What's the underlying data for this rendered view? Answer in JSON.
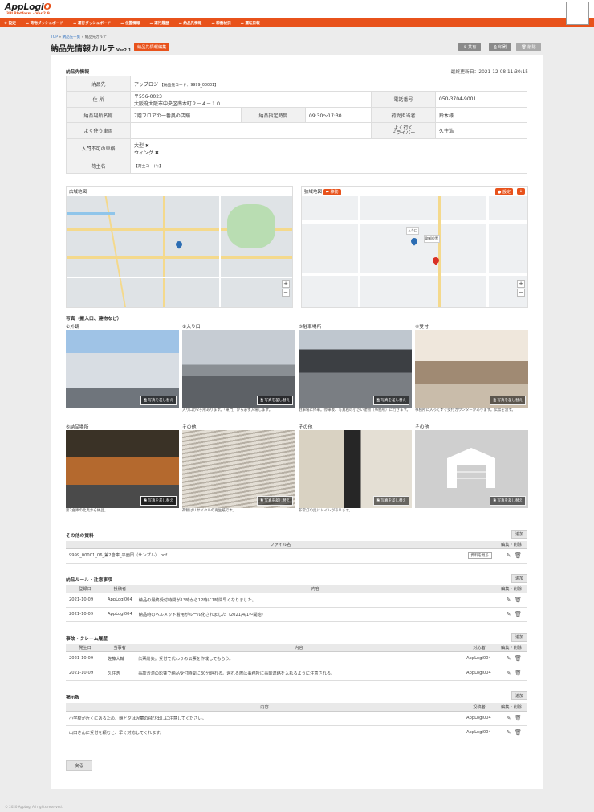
{
  "header": {
    "logo": "AppLogi",
    "logo_o": "O",
    "logo_sub": "3PLPlatform - Ver.2.9"
  },
  "nav": [
    "設定",
    "荷物ダッシュボード",
    "運行ダッシュボード",
    "位置情報",
    "運行履歴",
    "納品先情報",
    "稼働状況",
    "運転日報"
  ],
  "breadcrumb": {
    "top": "TOP",
    "list": "納品先一覧",
    "current": "納品先カルテ"
  },
  "page": {
    "title": "納品先情報カルテ",
    "version": "Ver2.1",
    "edit_label": "納品先情報編集",
    "share": "共有",
    "print": "印刷",
    "delete": "削除"
  },
  "info": {
    "section": "納品先情報",
    "updated": "最終更新日：2021-12-08 11:30:15",
    "dest_label": "納品先",
    "dest_value": "アップロジ",
    "dest_code": "【納品先コード：9999_00001】",
    "addr_label": "住 所",
    "addr_zip": "〒556-0023",
    "addr_line": "大阪府大阪市中央区南本町２－４－１０",
    "tel_label": "電話番号",
    "tel_value": "050-3704-9001",
    "place_label": "納品場所名称",
    "place_value": "7階フロアの一番奥の店舗",
    "time_label": "納品指定時間",
    "time_value": "09:30〜17:30",
    "person_label": "荷受担当者",
    "person_value": "鈴木様",
    "car_label": "よく使う車両",
    "driver_label": "よく行く\nドライバー",
    "driver_value": "久住浩",
    "ban_label": "入門不可の車格",
    "ban_1": "大型 ✖",
    "ban_2": "ウィング ✖",
    "owner_label": "荷主名",
    "owner_value": "【荷主コード：】"
  },
  "maps": {
    "wide": "広域地図",
    "narrow": "狭域地図",
    "move": "移動",
    "set": "設定",
    "entrance": "入り口",
    "current": "取卸位置"
  },
  "photos": {
    "section": "写真（搬入口、建物など）",
    "btn": "写真を差し替え",
    "items": [
      {
        "label": "①外観",
        "caption": ""
      },
      {
        "label": "②入り口",
        "caption": "入り口が2ヶ所あります。「東門」から必ず入場します。"
      },
      {
        "label": "③駐車場所",
        "caption": "駐車場に停車。停車後、写真右の小さい建物（事務所）に行きます。"
      },
      {
        "label": "④受付",
        "caption": "事務所に入ってすぐ受付カウンターがあります。伝票を渡す。"
      },
      {
        "label": "⑤納品場所",
        "caption": "第2倉庫の北奥から納品。"
      },
      {
        "label": "その他",
        "caption": "荷物はリサイクルの再生紙です。"
      },
      {
        "label": "その他",
        "caption": "非常灯の奥にトイレがあります。"
      },
      {
        "label": "その他",
        "caption": ""
      }
    ]
  },
  "docs": {
    "section": "その他の資料",
    "add": "追加",
    "col_file": "ファイル名",
    "col_edit": "編集・削除",
    "file": "9999_00001_06_第2倉庫_平面図（サンプル）.pdf",
    "view": "資料を見る"
  },
  "rules": {
    "section": "納品ルール・注意事項",
    "add": "追加",
    "col_date": "登録日",
    "col_user": "投稿者",
    "col_content": "内容",
    "col_edit": "編集・削除",
    "rows": [
      {
        "date": "2021-10-09",
        "user": "AppLogi004",
        "content": "納品の最終受付時間が13時から12時に1時間早くなりました。"
      },
      {
        "date": "2021-10-09",
        "user": "AppLogi004",
        "content": "納品時のヘルメット着用がルール化されました（2021/4/1〜開始）"
      }
    ]
  },
  "incidents": {
    "section": "事故・クレーム履歴",
    "add": "追加",
    "col_date": "発生日",
    "col_who": "当事者",
    "col_content": "内容",
    "col_resp": "対応者",
    "col_edit": "編集・削除",
    "rows": [
      {
        "date": "2021-10-09",
        "who": "佐藤大輔",
        "content": "伝票紛失。受付で代わりの伝票を作成してもらう。",
        "resp": "AppLogi004"
      },
      {
        "date": "2021-10-09",
        "who": "久住浩",
        "content": "事故渋滞の影響で納品受付時間に30分遅れる。遅れる際は事務所に事前連絡を入れるように注意される。",
        "resp": "AppLogi004"
      }
    ]
  },
  "board": {
    "section": "掲示板",
    "add": "追加",
    "col_content": "内容",
    "col_user": "投稿者",
    "col_edit": "編集・削除",
    "rows": [
      {
        "content": "小学校が近くにあるため、朝と夕は児童の飛び出しに注意してください。",
        "user": "AppLogi004"
      },
      {
        "content": "山田さんに受付を頼むと、早く対応してくれます。",
        "user": "AppLogi004"
      }
    ]
  },
  "back": "戻る",
  "footer": "© 2020 AppLogi All rights reserved.",
  "colors": {
    "accent": "#e8521b",
    "pin_blue": "#2c6db3",
    "pin_red": "#d93025"
  }
}
